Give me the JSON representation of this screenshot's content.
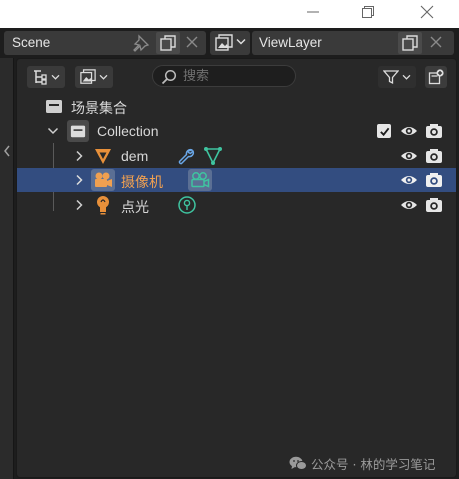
{
  "window": {
    "controls": [
      "minimize",
      "maximize",
      "close"
    ]
  },
  "topbar": {
    "scene_name": "Scene",
    "view_layer_name": "ViewLayer"
  },
  "outliner": {
    "search_placeholder": "搜索",
    "tree": [
      {
        "label": "场景集合",
        "icon": "scene-collection-icon"
      },
      {
        "label": "Collection",
        "icon": "collection-icon",
        "expanded": true
      },
      {
        "label": "dem",
        "icon": "mesh-object-icon",
        "modifiers": [
          "wrench-icon",
          "mesh-data-icon"
        ]
      },
      {
        "label": "摄像机",
        "icon": "camera-object-icon",
        "selected": true,
        "modifiers": [
          "camera-data-icon"
        ]
      },
      {
        "label": "点光",
        "icon": "light-object-icon",
        "modifiers": [
          "light-data-icon"
        ]
      }
    ],
    "colors": {
      "selection": "#334d80",
      "active_text": "#f0a050",
      "object_orange": "#e8903a",
      "data_green": "#3fc4a0",
      "modifier_blue": "#6aa7e8"
    }
  },
  "watermark": {
    "text": "公众号 · 林的学习笔记"
  }
}
